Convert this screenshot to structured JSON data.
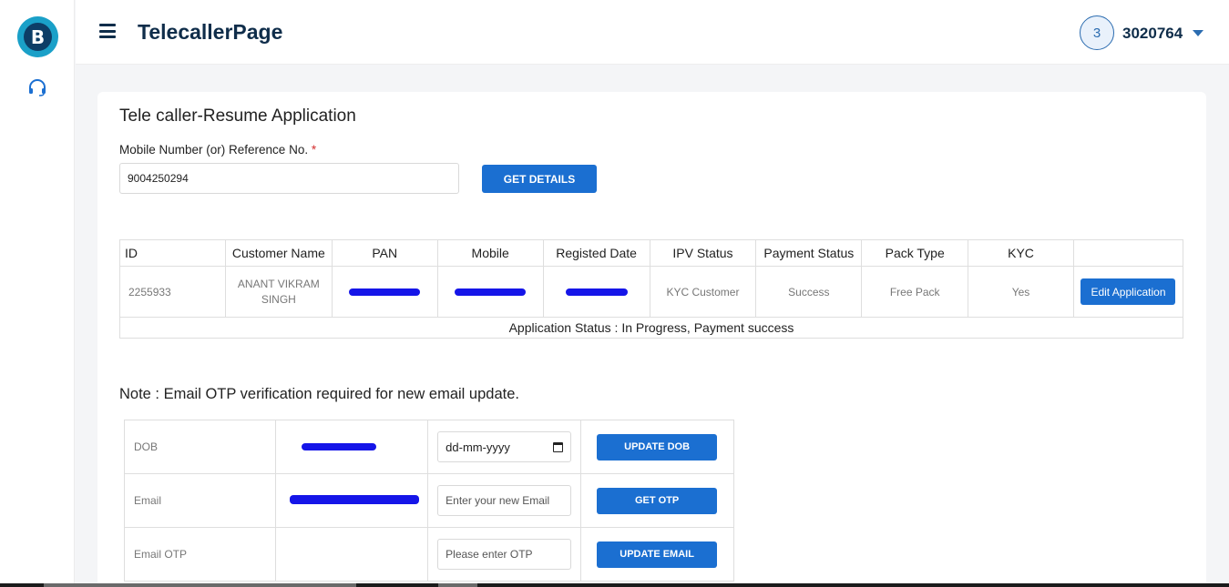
{
  "header": {
    "title": "TelecallerPage",
    "user_avatar_text": "3",
    "user_id": "3020764"
  },
  "sidebar": {
    "logo_letter": "B",
    "items": [
      {
        "icon": "headset-icon"
      }
    ]
  },
  "form": {
    "heading": "Tele caller-Resume Application",
    "mobile_label": "Mobile Number (or) Reference No.",
    "required_mark": "*",
    "mobile_value": "9004250294",
    "get_details_label": "GET DETAILS"
  },
  "results": {
    "columns": [
      "ID",
      "Customer Name",
      "PAN",
      "Mobile",
      "Registed Date",
      "IPV Status",
      "Payment Status",
      "Pack Type",
      "KYC",
      ""
    ],
    "row": {
      "id": "2255933",
      "customer_name": "ANANT VIKRAM SINGH",
      "pan": "[redacted]",
      "mobile": "[redacted]",
      "registered_date": "[redacted]",
      "ipv_status": "KYC Customer",
      "payment_status": "Success",
      "pack_type": "Free Pack",
      "kyc": "Yes",
      "action_label": "Edit Application"
    },
    "application_status": "Application Status : In Progress, Payment success"
  },
  "note": "Note : Email OTP verification required for new email update.",
  "update_rows": {
    "dob": {
      "label": "DOB",
      "current": "[redacted]",
      "input_placeholder": "dd-mm-yyyy",
      "button": "UPDATE DOB"
    },
    "email": {
      "label": "Email",
      "current": "[redacted]",
      "input_placeholder": "Enter your new Email",
      "button": "GET OTP"
    },
    "email_otp": {
      "label": "Email OTP",
      "current": "",
      "input_placeholder": "Please enter OTP",
      "button": "UPDATE EMAIL"
    }
  },
  "colors": {
    "primary_button": "#1b6fd1",
    "title_navy": "#0f2d4a",
    "redaction": "#1515e8",
    "required": "#d32f2f"
  }
}
